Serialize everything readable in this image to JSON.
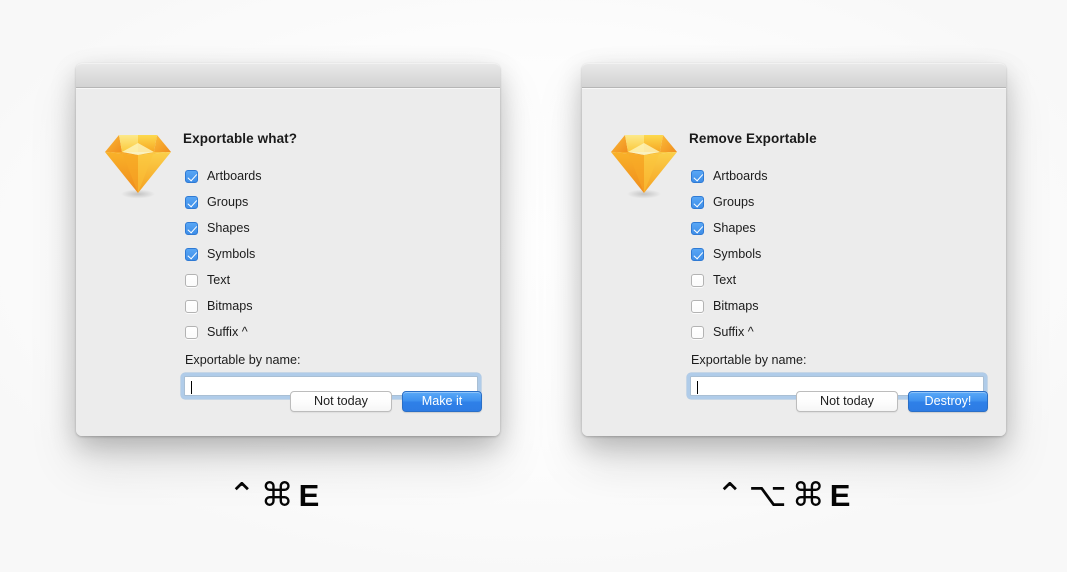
{
  "background": {
    "page_color": "#fcfcfc"
  },
  "colors": {
    "window_body": "#ececec",
    "titlebar": "#dedede",
    "checkbox_checked": "#3e8ee8",
    "primary_button": "#2f80e8",
    "focus_ring": "#7fb2e7",
    "logo_orange": "#f7941e",
    "logo_yellow": "#fdd231"
  },
  "dialogs": [
    {
      "id": "exportable-what",
      "title": "Exportable what?",
      "logo_icon": "sketch-diamond-icon",
      "checkboxes": [
        {
          "label": "Artboards",
          "checked": true
        },
        {
          "label": "Groups",
          "checked": true
        },
        {
          "label": "Shapes",
          "checked": true
        },
        {
          "label": "Symbols",
          "checked": true
        },
        {
          "label": "Text",
          "checked": false
        },
        {
          "label": "Bitmaps",
          "checked": false
        },
        {
          "label": "Suffix ^",
          "checked": false
        }
      ],
      "field": {
        "label": "Exportable by name:",
        "value": "",
        "placeholder": "",
        "focused": true
      },
      "buttons": {
        "cancel": "Not today",
        "confirm": "Make it"
      },
      "shortcut": {
        "modifiers": [
          "⌃",
          "⌘"
        ],
        "key": "E",
        "text": "⌃⌘E"
      }
    },
    {
      "id": "remove-exportable",
      "title": "Remove Exportable",
      "logo_icon": "sketch-diamond-icon",
      "checkboxes": [
        {
          "label": "Artboards",
          "checked": true
        },
        {
          "label": "Groups",
          "checked": true
        },
        {
          "label": "Shapes",
          "checked": true
        },
        {
          "label": "Symbols",
          "checked": true
        },
        {
          "label": "Text",
          "checked": false
        },
        {
          "label": "Bitmaps",
          "checked": false
        },
        {
          "label": "Suffix ^",
          "checked": false
        }
      ],
      "field": {
        "label": "Exportable by name:",
        "value": "",
        "placeholder": "",
        "focused": true
      },
      "buttons": {
        "cancel": "Not today",
        "confirm": "Destroy!"
      },
      "shortcut": {
        "modifiers": [
          "⌃",
          "⌥",
          "⌘"
        ],
        "key": "E",
        "text": "⌃⌥⌘E"
      }
    }
  ]
}
